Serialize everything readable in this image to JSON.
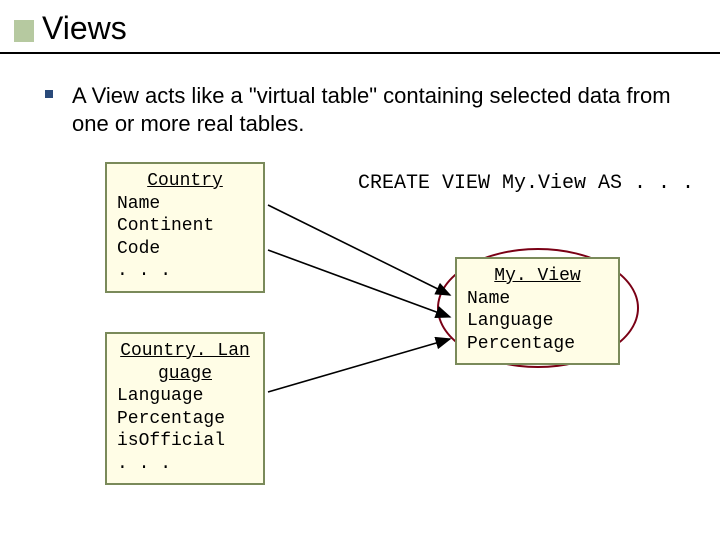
{
  "title": "Views",
  "bullet_text": "A View acts like a \"virtual table\" containing selected data from one or more real tables.",
  "sql": "CREATE VIEW My.View AS . . .",
  "tables": {
    "country": {
      "name": "Country",
      "rows": [
        "Name",
        "Continent",
        "Code",
        ". . ."
      ]
    },
    "country_lang": {
      "name": "Country. Lan",
      "name2": "guage",
      "rows": [
        "Language",
        "Percentage",
        "isOfficial",
        ". . ."
      ]
    },
    "myview": {
      "name": "My. View",
      "rows": [
        "Name",
        "Language",
        "Percentage"
      ]
    }
  }
}
